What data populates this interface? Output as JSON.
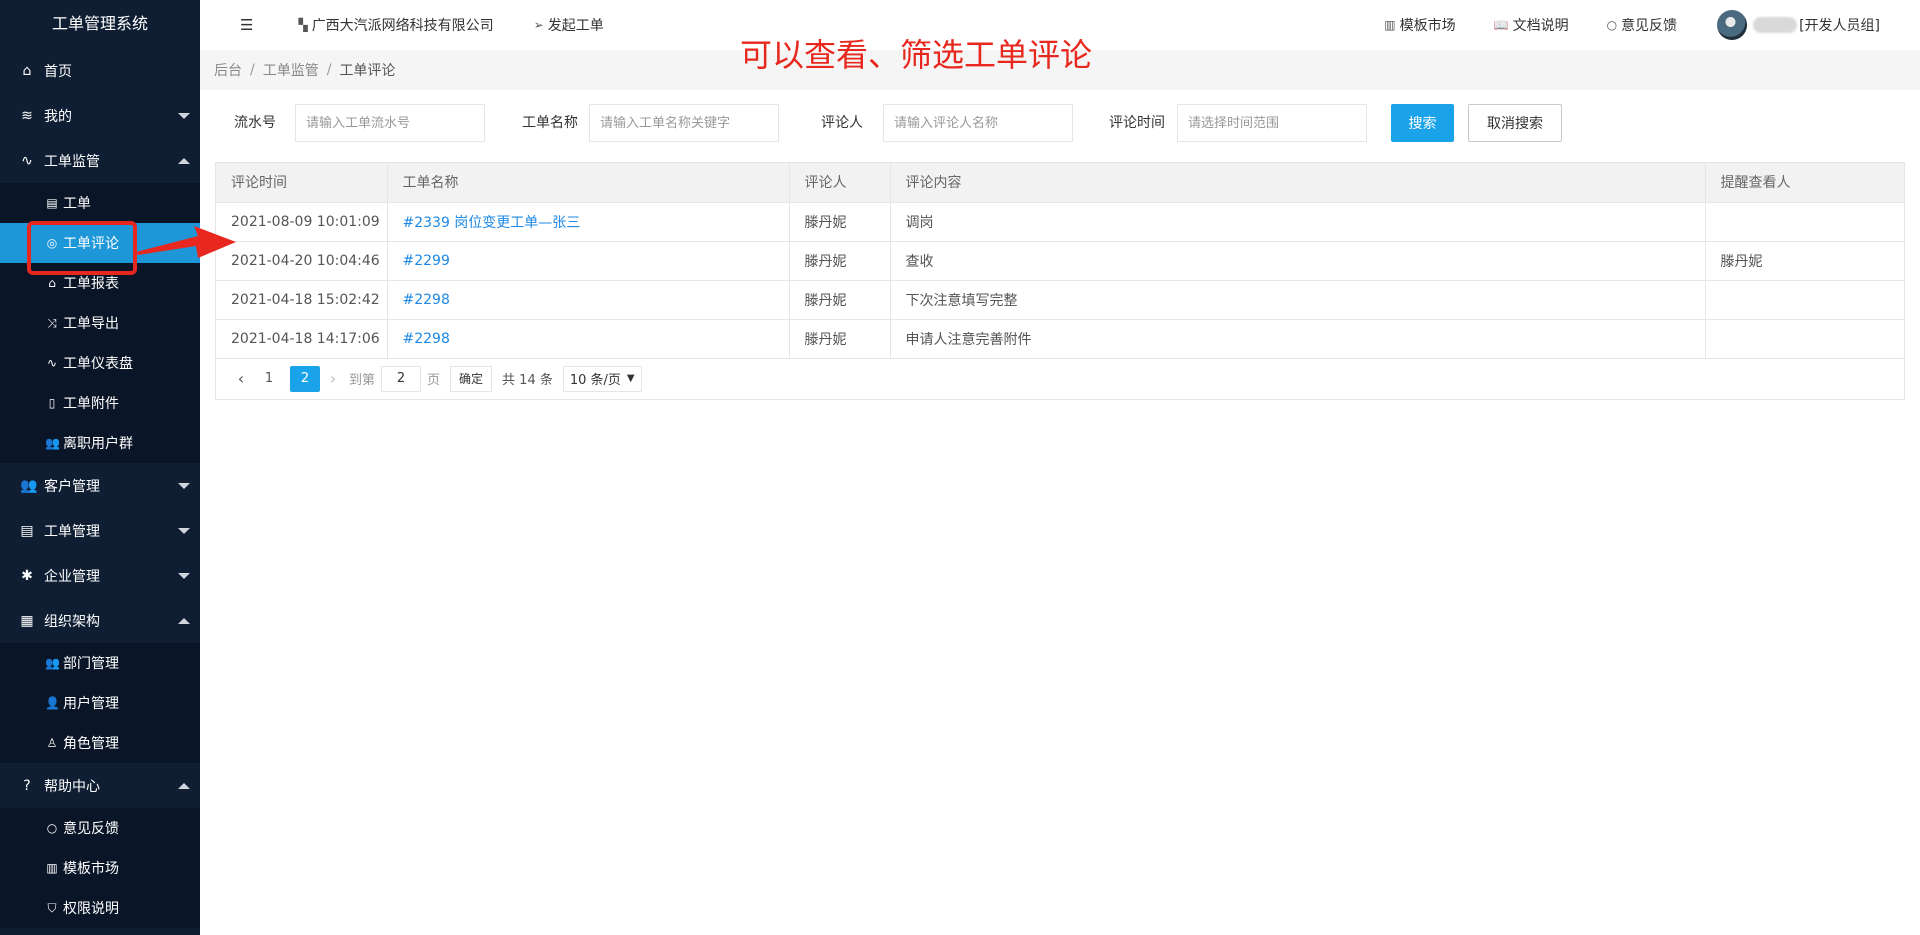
{
  "sidebar": {
    "brand": "工单管理系统",
    "home": "首页",
    "mine": "我的",
    "monitor": {
      "label": "工单监管",
      "items": [
        "工单",
        "工单评论",
        "工单报表",
        "工单导出",
        "工单仪表盘",
        "工单附件",
        "离职用户群"
      ]
    },
    "customer": "客户管理",
    "ticket_mgmt": "工单管理",
    "enterprise": "企业管理",
    "org": {
      "label": "组织架构",
      "items": [
        "部门管理",
        "用户管理",
        "角色管理"
      ]
    },
    "help": {
      "label": "帮助中心",
      "items": [
        "意见反馈",
        "模板市场",
        "权限说明"
      ]
    }
  },
  "topbar": {
    "company": "广西大汽派网络科技有限公司",
    "launch": "发起工单",
    "template_market": "模板市场",
    "docs": "文档说明",
    "feedback": "意见反馈",
    "role": "[开发人员组]"
  },
  "breadcrumb": {
    "root": "后台",
    "parent": "工单监管",
    "current": "工单评论"
  },
  "annotation": "可以查看、筛选工单评论",
  "filters": {
    "serial_label": "流水号",
    "serial_placeholder": "请输入工单流水号",
    "name_label": "工单名称",
    "name_placeholder": "请输入工单名称关键字",
    "commenter_label": "评论人",
    "commenter_placeholder": "请输入评论人名称",
    "time_label": "评论时间",
    "time_placeholder": "请选择时间范围",
    "search": "搜索",
    "cancel": "取消搜索"
  },
  "table": {
    "headers": [
      "评论时间",
      "工单名称",
      "评论人",
      "评论内容",
      "提醒查看人"
    ],
    "rows": [
      [
        "2021-08-09 10:01:09",
        "#2339 岗位变更工单—张三",
        "滕丹妮",
        "调岗",
        ""
      ],
      [
        "2021-04-20 10:04:46",
        "#2299",
        "滕丹妮",
        "查收",
        "滕丹妮"
      ],
      [
        "2021-04-18 15:02:42",
        "#2298",
        "滕丹妮",
        "下次注意填写完整",
        ""
      ],
      [
        "2021-04-18 14:17:06",
        "#2298",
        "滕丹妮",
        "申请人注意完善附件",
        ""
      ]
    ]
  },
  "pagination": {
    "pages": [
      "1",
      "2"
    ],
    "current": "2",
    "goto_label": "到第",
    "goto_value": "2",
    "page_unit": "页",
    "ok": "确定",
    "total": "共 14 条",
    "page_size": "10 条/页"
  },
  "colors": {
    "sidebar_bg": "#0f1e33",
    "accent": "#1aa3e8",
    "annotation": "#e8281e",
    "link": "#1e88e5"
  }
}
